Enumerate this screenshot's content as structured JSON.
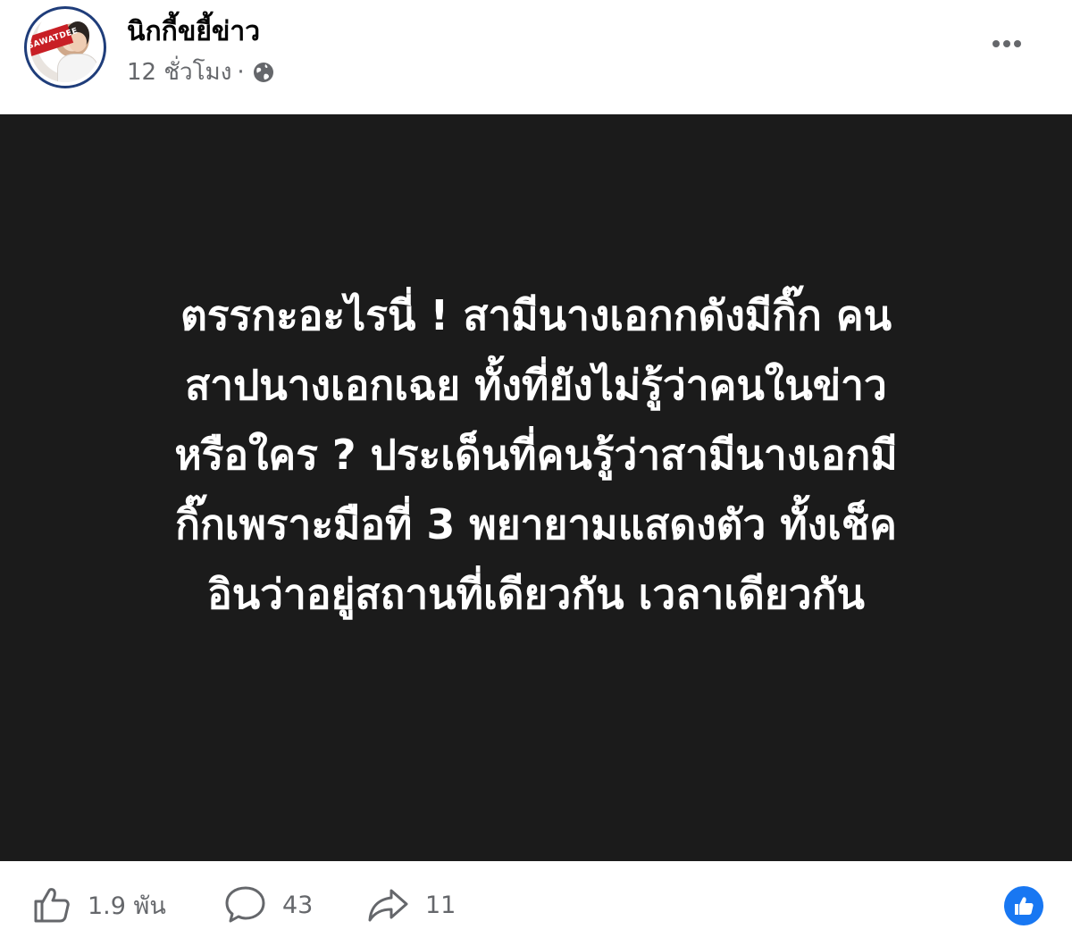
{
  "post": {
    "page_name": "นิกกี้ขยี้ข่าว",
    "time_ago": "12 ชั่วโมง",
    "separator": "·",
    "privacy_icon": "globe-icon",
    "more_icon": "more-horizontal-icon",
    "avatar_banner_text": "SAWATDEE",
    "content_lines": [
      "ตรรกะอะไรนี่ ! สามีนางเอกกดังมีกิ๊ก คน",
      "สาปนางเอกเฉย ทั้งที่ยังไม่รู้ว่าคนในข่าว",
      "หรือใคร ? ประเด็นที่คนรู้ว่าสามีนางเอกมี",
      "กิ๊กเพราะมือที่ 3 พยายามแสดงตัว ทั้งเช็ค",
      "อินว่าอยู่สถานที่เดียวกัน เวลาเดียวกัน"
    ],
    "content_background": "#1b1b1b",
    "content_text_color": "#ffffff"
  },
  "footer": {
    "like_icon": "thumbs-up-icon",
    "likes": "1.9 พัน",
    "comment_icon": "comment-icon",
    "comments": "43",
    "share_icon": "share-icon",
    "shares": "11",
    "reaction_icon": "like-reaction-icon",
    "reaction_color": "#1877f2"
  }
}
